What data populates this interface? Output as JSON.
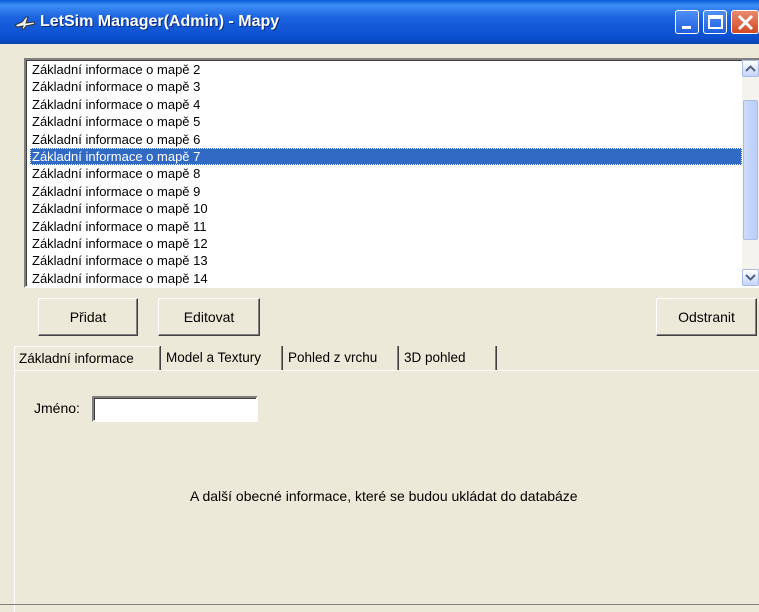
{
  "window": {
    "title": "LetSim Manager(Admin) - Mapy",
    "controls": [
      "minimize-icon",
      "maximize-icon",
      "close-icon"
    ]
  },
  "list": {
    "items": [
      "Základní informace o mapě 2",
      "Základní informace o mapě 3",
      "Základní informace o mapě 4",
      "Základní informace o mapě 5",
      "Základní informace o mapě 6",
      "Základní informace o mapě 7",
      "Základní informace o mapě 8",
      "Základní informace o mapě 9",
      "Základní informace o mapě 10",
      "Základní informace o mapě 11",
      "Základní informace o mapě 12",
      "Základní informace o mapě 13",
      "Základní informace o mapě 14"
    ],
    "selected_index": 5
  },
  "buttons": {
    "add": "Přidat",
    "edit": "Editovat",
    "remove": "Odstranit"
  },
  "tabs": [
    "Základní informace",
    "Model a Textury",
    "Pohled z vrchu",
    "3D pohled"
  ],
  "active_tab": 0,
  "form": {
    "name_label": "Jméno:",
    "name_value": ""
  },
  "info_text": "A další obecné informace, které se budou ukládat do databáze",
  "colors": {
    "selection": "#316ac5",
    "titlebar": "#0a4fcf",
    "window_bg": "#ece9d8"
  }
}
